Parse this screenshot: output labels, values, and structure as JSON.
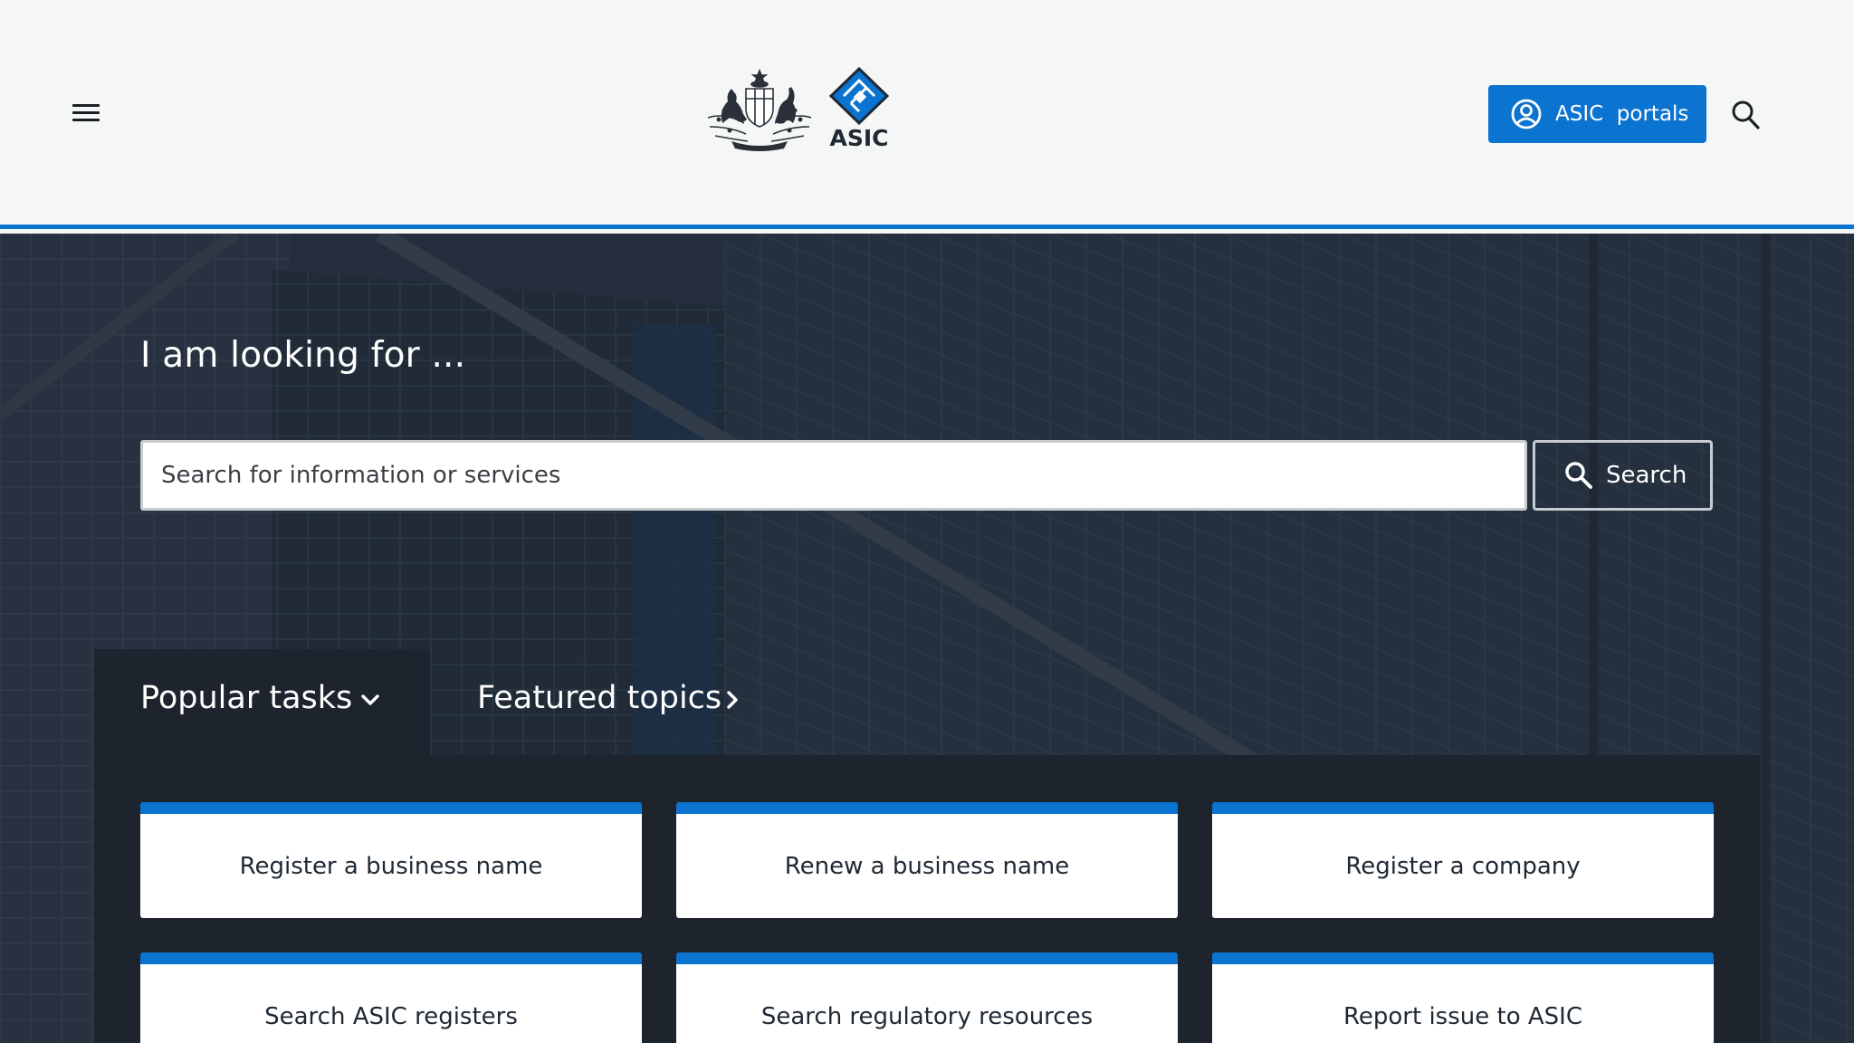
{
  "header": {
    "menu_icon": "hamburger-menu-icon",
    "logo": {
      "crest_icon": "commonwealth-coat-of-arms-icon",
      "mark_icon": "asic-diamond-logo-icon",
      "wordmark": "ASIC"
    },
    "portals_button": {
      "icon": "user-circle-icon",
      "label": "ASIC  portals"
    },
    "search_icon": "search-icon",
    "accent_color": "#0b73d0"
  },
  "hero": {
    "title": "I am looking for ...",
    "search": {
      "placeholder": "Search for information or services",
      "value": "",
      "button_label": "Search",
      "button_icon": "search-icon"
    }
  },
  "tabs": [
    {
      "label": "Popular tasks",
      "icon": "chevron-down-icon",
      "active": true
    },
    {
      "label": "Featured topics",
      "icon": "chevron-right-icon",
      "active": false
    }
  ],
  "popular_tasks": [
    {
      "label": "Register a business name"
    },
    {
      "label": "Renew a business name"
    },
    {
      "label": "Register a company"
    },
    {
      "label": "Search ASIC registers"
    },
    {
      "label": "Search regulatory resources"
    },
    {
      "label": "Report issue to ASIC"
    }
  ],
  "colors": {
    "brand_blue": "#0b73d0",
    "header_bg": "#f5f7f7",
    "panel_dark": "#1d242d"
  }
}
